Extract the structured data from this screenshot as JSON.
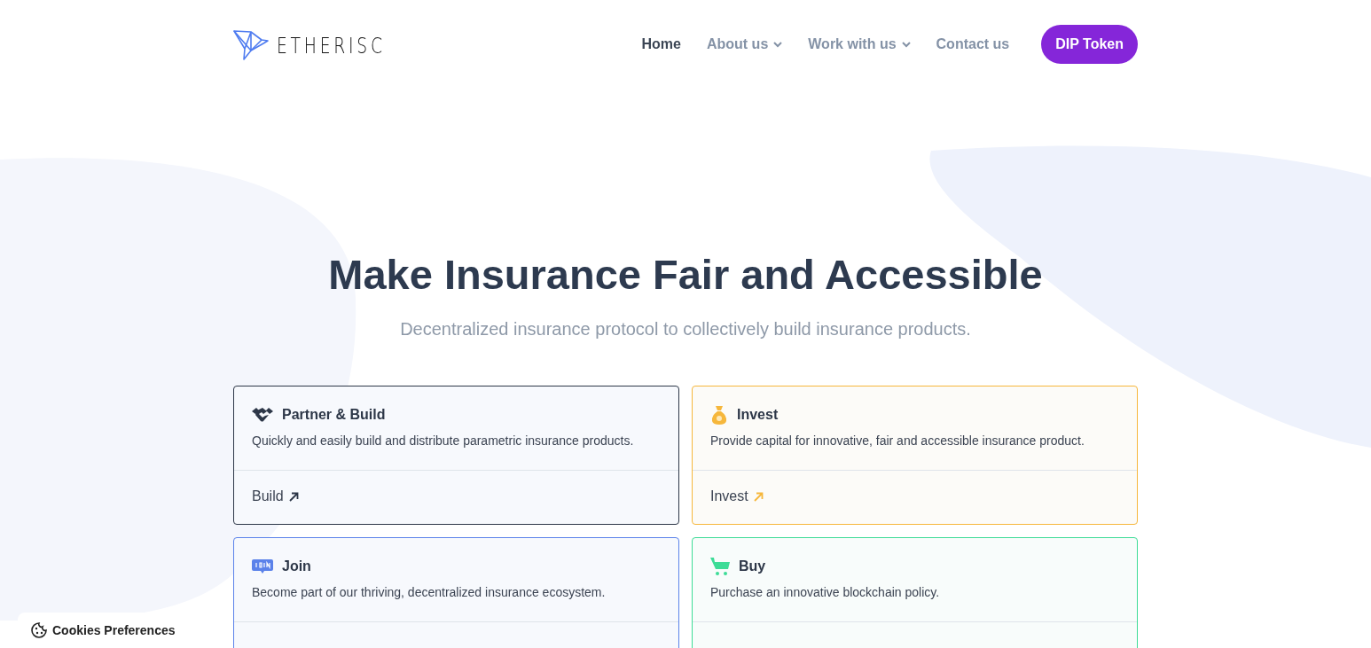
{
  "logo": {
    "text": "ETHERISC"
  },
  "nav": [
    {
      "label": "Home",
      "selected": true,
      "dropdown": false
    },
    {
      "label": "About us",
      "selected": false,
      "dropdown": true
    },
    {
      "label": "Work with us",
      "selected": false,
      "dropdown": true
    },
    {
      "label": "Contact us",
      "selected": false,
      "dropdown": false
    }
  ],
  "cta_button": "DIP Token",
  "hero": {
    "title": "Make Insurance Fair and Accessible",
    "subtitle": "Decentralized insurance protocol to collectively build insurance products."
  },
  "cards": [
    {
      "kind": "handshake",
      "color": "#2d3748",
      "title": "Partner & Build",
      "description": "Quickly and easily build and distribute parametric insurance products.",
      "link": "Build"
    },
    {
      "kind": "moneybag",
      "color": "#f6b73c",
      "title": "Invest",
      "description": "Provide capital for innovative, fair and accessible insurance product.",
      "link": "Invest"
    },
    {
      "kind": "join",
      "color": "#5b82ea",
      "title": "Join",
      "description": "Become part of our thriving, decentralized insurance ecosystem."
    },
    {
      "kind": "cart",
      "color": "#3ddc97",
      "title": "Buy",
      "description": "Purchase an innovative blockchain policy."
    }
  ],
  "cookies_button": "Cookies Preferences"
}
